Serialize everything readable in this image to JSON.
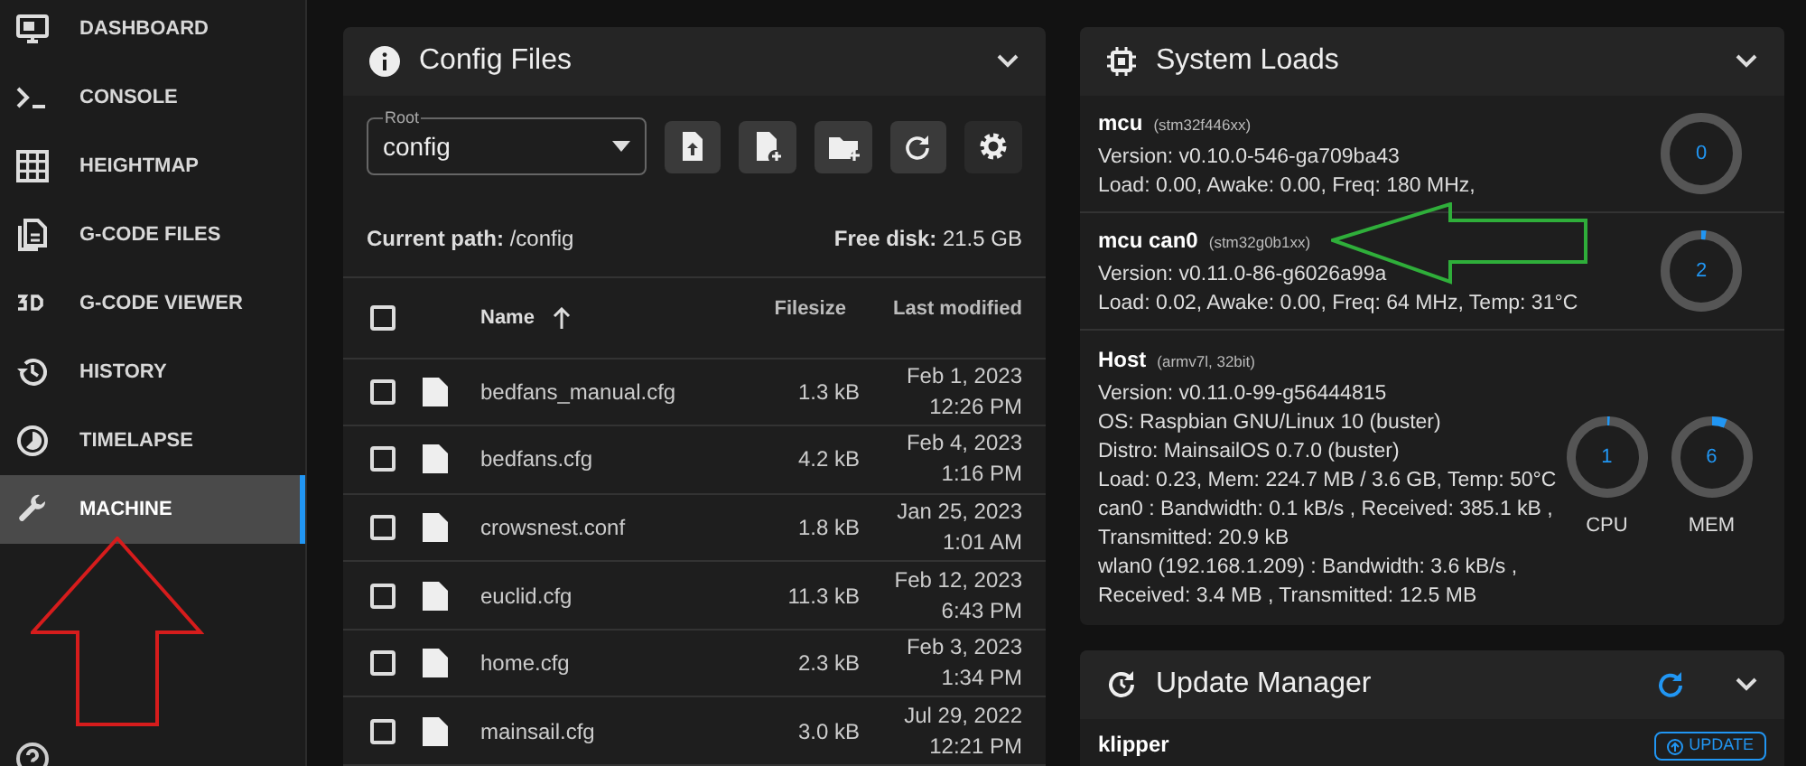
{
  "sidebar": {
    "items": [
      {
        "label": "DASHBOARD",
        "selected": false
      },
      {
        "label": "CONSOLE",
        "selected": false
      },
      {
        "label": "HEIGHTMAP",
        "selected": false
      },
      {
        "label": "G-CODE FILES",
        "selected": false
      },
      {
        "label": "G-CODE VIEWER",
        "selected": false
      },
      {
        "label": "HISTORY",
        "selected": false
      },
      {
        "label": "TIMELAPSE",
        "selected": false
      },
      {
        "label": "MACHINE",
        "selected": true
      }
    ]
  },
  "config_files": {
    "title": "Config Files",
    "root_select": {
      "label": "Root",
      "value": "config"
    },
    "current_path": {
      "label": "Current path:",
      "value": "/config"
    },
    "free_disk": {
      "label": "Free disk:",
      "value": "21.5 GB"
    },
    "table": {
      "all_checked": false,
      "columns": [
        "Name",
        "Filesize",
        "Last modified"
      ],
      "rows": [
        {
          "name": "bedfans_manual.cfg",
          "size": "1.3 kB",
          "date": "Feb 1, 2023",
          "time": "12:26 PM",
          "checked": false
        },
        {
          "name": "bedfans.cfg",
          "size": "4.2 kB",
          "date": "Feb 4, 2023",
          "time": "1:16 PM",
          "checked": false
        },
        {
          "name": "crowsnest.conf",
          "size": "1.8 kB",
          "date": "Jan 25, 2023",
          "time": "1:01 AM",
          "checked": false
        },
        {
          "name": "euclid.cfg",
          "size": "11.3 kB",
          "date": "Feb 12, 2023",
          "time": "6:43 PM",
          "checked": false
        },
        {
          "name": "home.cfg",
          "size": "2.3 kB",
          "date": "Feb 3, 2023",
          "time": "1:34 PM",
          "checked": false
        },
        {
          "name": "mainsail.cfg",
          "size": "3.0 kB",
          "date": "Jul 29, 2022",
          "time": "12:21 PM",
          "checked": false
        }
      ]
    }
  },
  "system_loads": {
    "title": "System Loads",
    "mcus": [
      {
        "name": "mcu",
        "chip": "(stm32f446xx)",
        "lines": [
          "Version: v0.10.0-546-ga709ba43",
          "Load: 0.00, Awake: 0.00, Freq: 180 MHz,"
        ],
        "load": "0",
        "level": 0
      },
      {
        "name": "mcu can0",
        "chip": "(stm32g0b1xx)",
        "lines": [
          "Version: v0.11.0-86-g6026a99a",
          "Load: 0.02, Awake: 0.00, Freq: 64 MHz, Temp: 31°C"
        ],
        "load": "2",
        "level": 0.02
      }
    ],
    "host": {
      "name": "Host",
      "chip": "(armv7l, 32bit)",
      "lines": [
        "Version: v0.11.0-99-g56444815",
        "OS: Raspbian GNU/Linux 10 (buster)",
        "Distro: MainsailOS 0.7.0 (buster)",
        "Load: 0.23, Mem: 224.7 MB / 3.6 GB, Temp: 50°C",
        "can0 : Bandwidth: 0.1 kB/s , Received: 385.1 kB ,",
        "Transmitted: 20.9 kB",
        "wlan0 (192.168.1.209) : Bandwidth: 3.6 kB/s ,",
        "Received: 3.4 MB , Transmitted: 12.5 MB"
      ],
      "gauges": [
        {
          "value": "1",
          "label": "CPU",
          "level": 0.01
        },
        {
          "value": "6",
          "label": "MEM",
          "level": 0.06
        }
      ]
    }
  },
  "update_manager": {
    "title": "Update Manager",
    "items": [
      {
        "name": "klipper",
        "button": "UPDATE"
      }
    ]
  }
}
